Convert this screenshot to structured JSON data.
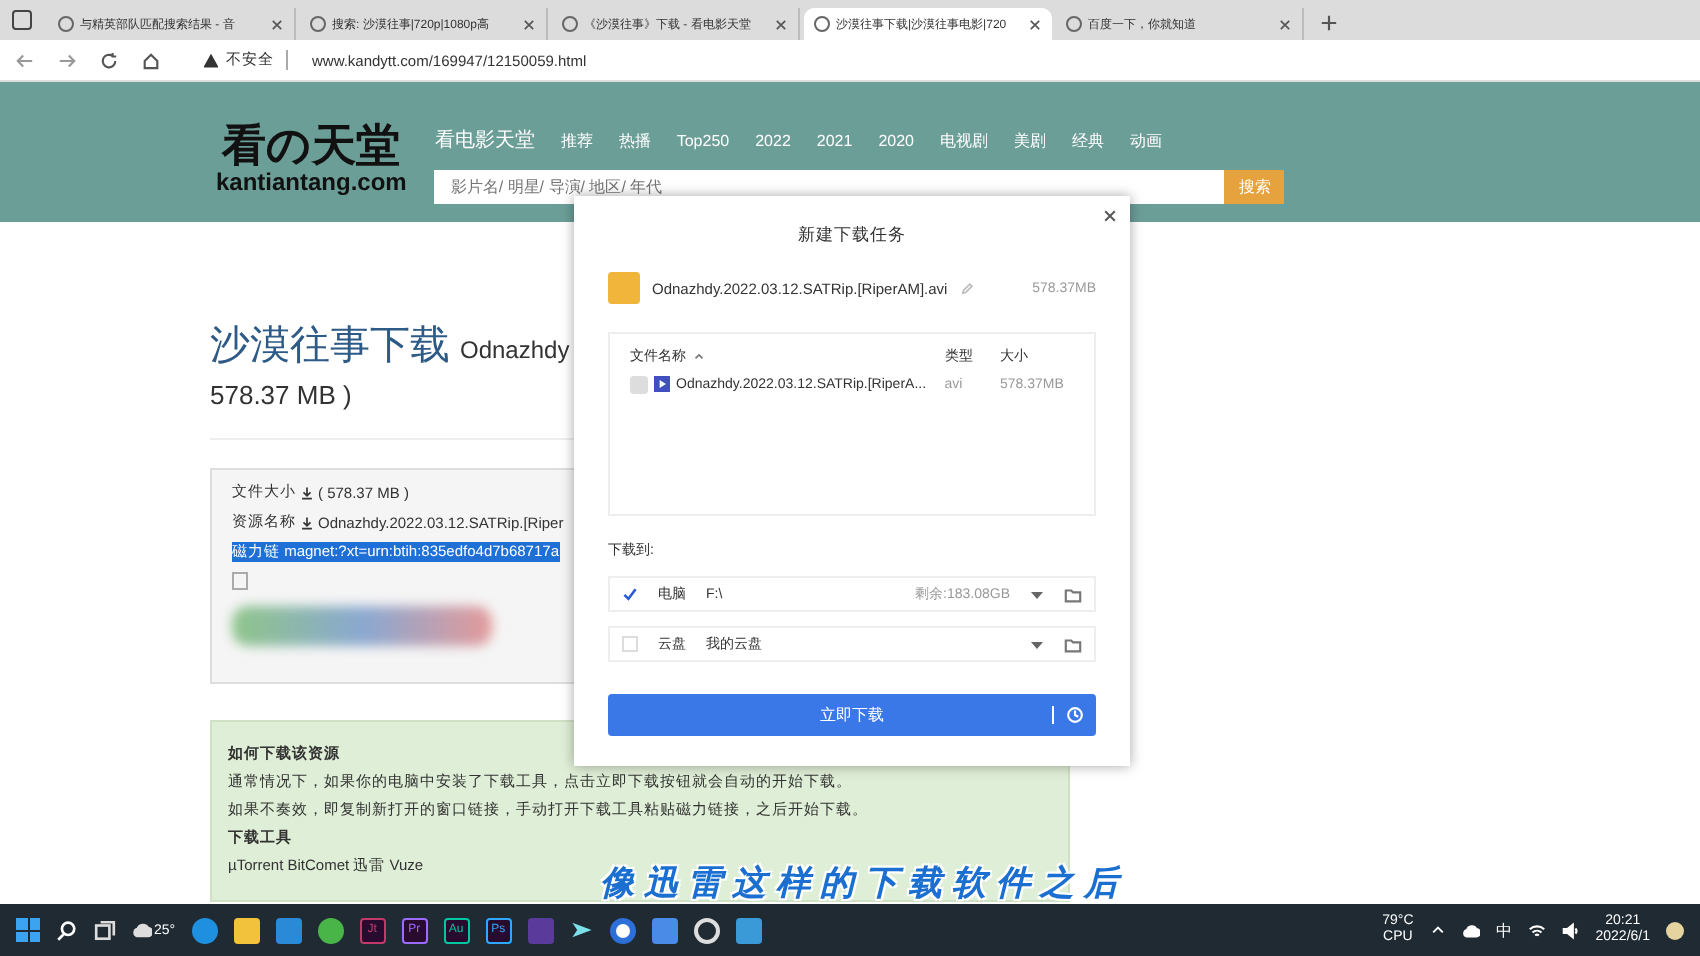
{
  "browser": {
    "tabs": [
      {
        "title": "与精英部队匹配搜索结果 - 音",
        "selected": false
      },
      {
        "title": "搜索: 沙漠往事|720p|1080p高",
        "selected": false
      },
      {
        "title": "《沙漠往事》下载 - 看电影天堂",
        "selected": false
      },
      {
        "title": "沙漠往事下载|沙漠往事电影|720",
        "selected": true
      },
      {
        "title": "百度一下，你就知道",
        "selected": false
      }
    ],
    "address": {
      "security": "不安全",
      "url": "www.kandytt.com/169947/12150059.html"
    }
  },
  "site": {
    "logo": {
      "title": "看の天堂",
      "subtitle": "kantiantang.com"
    },
    "nav": [
      "看电影天堂",
      "推荐",
      "热播",
      "Top250",
      "2022",
      "2021",
      "2020",
      "电视剧",
      "美剧",
      "经典",
      "动画"
    ],
    "search": {
      "placeholder": "影片名/ 明星/ 导演/ 地区/ 年代",
      "button": "搜索"
    }
  },
  "article": {
    "title": "沙漠往事下载",
    "title_suffix": "Odnazhdy",
    "title_tail": "578.37 MB )",
    "info": {
      "size_label": "文件大小",
      "size": "( 578.37 MB )",
      "name_label": "资源名称",
      "name": "Odnazhdy.2022.03.12.SATRip.[Riper",
      "magnet": "磁力链 magnet:?xt=urn:btih:835edfo4d7b68717a"
    },
    "help": {
      "heading": "如何下载该资源",
      "lines": [
        "通常情况下，如果你的电脑中安装了下载工具，点击立即下载按钮就会自动的开始下载。",
        "如果不奏效，即复制新打开的窗口链接，手动打开下载工具粘贴磁力链接，之后开始下载。"
      ],
      "tools_heading": "下载工具",
      "tools": "µTorrent BitComet 迅雷 Vuze"
    }
  },
  "dialog": {
    "title": "新建下载任务",
    "file_name": "Odnazhdy.2022.03.12.SATRip.[RiperAM].avi",
    "file_size": "578.37MB",
    "columns": [
      "文件名称",
      "类型",
      "大小"
    ],
    "files": [
      {
        "name": "Odnazhdy.2022.03.12.SATRip.[RiperA...",
        "type": "avi",
        "size": "578.37MB",
        "disabled": true
      }
    ],
    "save_label": "下载到:",
    "locations": [
      {
        "label": "电脑",
        "path": "F:\\",
        "free": "剩余:183.08GB",
        "checked": true
      },
      {
        "label": "云盘",
        "path": "我的云盘",
        "checked": false
      }
    ],
    "button": "立即下载"
  },
  "subtitle": "像迅雷这样的下载软件之后",
  "taskbar": {
    "weather": "25°",
    "apps": [
      {
        "kind": "edge"
      },
      {
        "kind": "folder"
      },
      {
        "kind": "mail"
      },
      {
        "kind": "green"
      },
      {
        "kind": "text",
        "label": "Jt",
        "color": "#c23a6a"
      },
      {
        "kind": "text",
        "label": "Pr",
        "color": "#9b6cff"
      },
      {
        "kind": "text",
        "label": "Au",
        "color": "#00c8a0"
      },
      {
        "kind": "text",
        "label": "Ps",
        "color": "#31a8ff"
      },
      {
        "kind": "purple"
      },
      {
        "kind": "arrow"
      },
      {
        "kind": "bluecircle"
      },
      {
        "kind": "bird"
      },
      {
        "kind": "record"
      },
      {
        "kind": "photo"
      }
    ],
    "cpu_temp": "79°C",
    "cpu_label": "CPU",
    "ime": "中",
    "time": "20:21",
    "date": "2022/6/1"
  }
}
